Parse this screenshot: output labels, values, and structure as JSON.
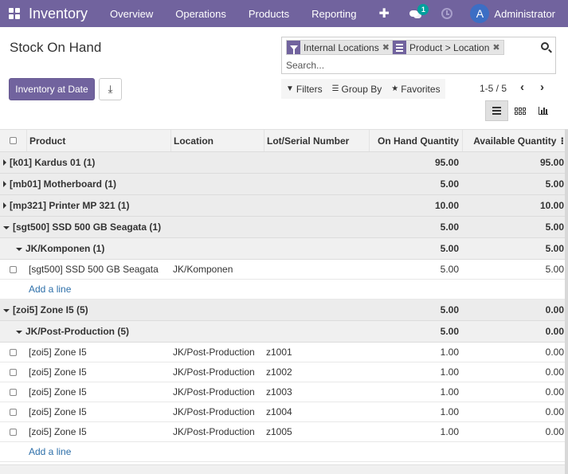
{
  "navbar": {
    "app_name": "Inventory",
    "menu": [
      "Overview",
      "Operations",
      "Products",
      "Reporting"
    ],
    "plus": "✚",
    "chat_badge": "1",
    "avatar_letter": "A",
    "user_name": "Administrator"
  },
  "control": {
    "title": "Stock On Hand",
    "inventory_at_date": "Inventory at Date",
    "download_glyph": "⤓",
    "facets": [
      "Internal Locations",
      "Product > Location"
    ],
    "facet_close": "✖",
    "search_placeholder": "Search...",
    "filters": "Filters",
    "group_by": "Group By",
    "favorites": "Favorites",
    "pager": "1-5 / 5",
    "pager_prev": "‹",
    "pager_next": "›"
  },
  "table": {
    "headers": [
      "Product",
      "Location",
      "Lot/Serial Number",
      "On Hand Quantity",
      "Available Quantity"
    ],
    "options_glyph": "⁝",
    "add_line": "Add a line",
    "groups": [
      {
        "label": "[k01] Kardus 01 (1)",
        "on_hand": "95.00",
        "available": "95.00"
      },
      {
        "label": "[mb01] Motherboard (1)",
        "on_hand": "5.00",
        "available": "5.00"
      },
      {
        "label": "[mp321] Printer MP 321 (1)",
        "on_hand": "10.00",
        "available": "10.00"
      },
      {
        "label": "[sgt500] SSD 500 GB Seagata (1)",
        "on_hand": "5.00",
        "available": "5.00",
        "sub": {
          "label": "JK/Komponen (1)",
          "on_hand": "5.00",
          "available": "5.00"
        },
        "rows": [
          {
            "product": "[sgt500] SSD 500 GB Seagata",
            "location": "JK/Komponen",
            "lot": "",
            "on_hand": "5.00",
            "available": "5.00"
          }
        ]
      },
      {
        "label": "[zoi5] Zone I5 (5)",
        "on_hand": "5.00",
        "available": "0.00",
        "sub": {
          "label": "JK/Post-Production (5)",
          "on_hand": "5.00",
          "available": "0.00"
        },
        "rows": [
          {
            "product": "[zoi5] Zone I5",
            "location": "JK/Post-Production",
            "lot": "z1001",
            "on_hand": "1.00",
            "available": "0.00"
          },
          {
            "product": "[zoi5] Zone I5",
            "location": "JK/Post-Production",
            "lot": "z1002",
            "on_hand": "1.00",
            "available": "0.00"
          },
          {
            "product": "[zoi5] Zone I5",
            "location": "JK/Post-Production",
            "lot": "z1003",
            "on_hand": "1.00",
            "available": "0.00"
          },
          {
            "product": "[zoi5] Zone I5",
            "location": "JK/Post-Production",
            "lot": "z1004",
            "on_hand": "1.00",
            "available": "0.00"
          },
          {
            "product": "[zoi5] Zone I5",
            "location": "JK/Post-Production",
            "lot": "z1005",
            "on_hand": "1.00",
            "available": "0.00"
          }
        ]
      }
    ]
  }
}
